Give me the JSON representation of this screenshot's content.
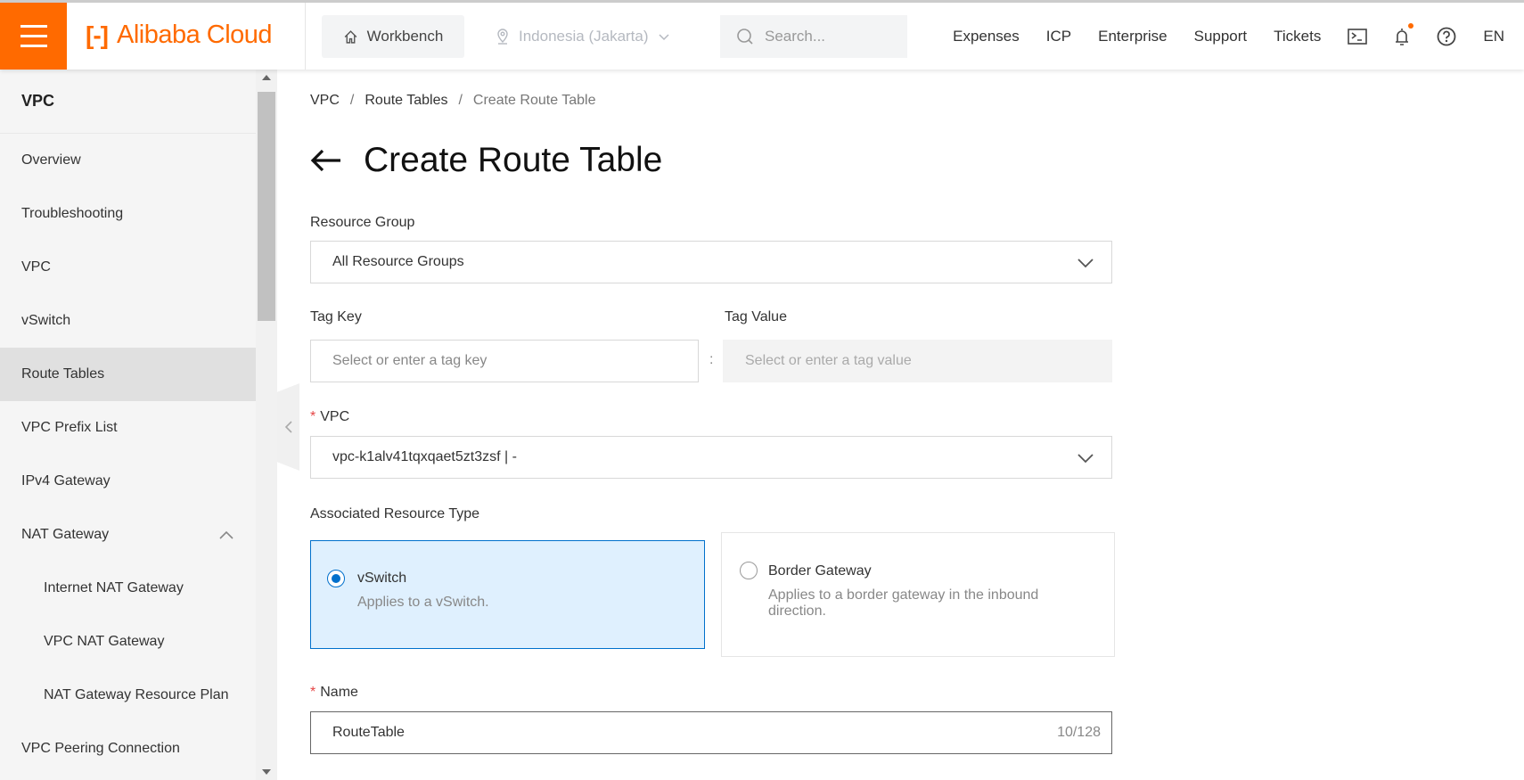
{
  "header": {
    "brand": "Alibaba Cloud",
    "workbench": "Workbench",
    "region": "Indonesia (Jakarta)",
    "search_placeholder": "Search...",
    "nav": [
      "Expenses",
      "ICP",
      "Enterprise",
      "Support",
      "Tickets"
    ],
    "lang": "EN",
    "accent": "#ff6a00"
  },
  "sidebar": {
    "title": "VPC",
    "items": [
      {
        "label": "Overview"
      },
      {
        "label": "Troubleshooting"
      },
      {
        "label": "VPC"
      },
      {
        "label": "vSwitch"
      },
      {
        "label": "Route Tables",
        "active": true
      },
      {
        "label": "VPC Prefix List"
      },
      {
        "label": "IPv4 Gateway"
      },
      {
        "label": "NAT Gateway",
        "expanded": true
      },
      {
        "label": "Internet NAT Gateway"
      },
      {
        "label": "VPC NAT Gateway"
      },
      {
        "label": "NAT Gateway Resource Plan"
      },
      {
        "label": "VPC Peering Connection"
      }
    ]
  },
  "breadcrumb": [
    "VPC",
    "/",
    "Route Tables",
    "/",
    "Create Route Table"
  ],
  "page_title": "Create Route Table",
  "form": {
    "resource_group": {
      "label": "Resource Group",
      "value": "All Resource Groups"
    },
    "tag_key": {
      "label": "Tag Key",
      "placeholder": "Select or enter a tag key"
    },
    "tag_sep": ":",
    "tag_value": {
      "label": "Tag Value",
      "placeholder": "Select or enter a tag value"
    },
    "vpc": {
      "required": "*",
      "label": "VPC",
      "value": "vpc-k1alv41tqxqaet5zt3zsf | -"
    },
    "assoc": {
      "label": "Associated Resource Type",
      "options": [
        {
          "title": "vSwitch",
          "desc": "Applies to a vSwitch.",
          "selected": true
        },
        {
          "title": "Border Gateway",
          "desc": "Applies to a border gateway in the inbound direction.",
          "selected": false
        }
      ]
    },
    "name": {
      "required": "*",
      "label": "Name",
      "value": "RouteTable",
      "counter": "10/128"
    }
  }
}
